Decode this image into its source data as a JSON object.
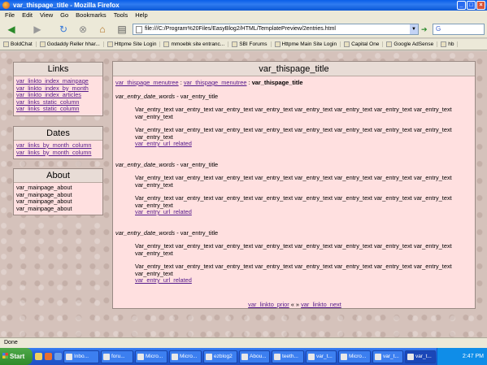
{
  "window": {
    "title": "var_thispage_title - Mozilla Firefox"
  },
  "menu": [
    "File",
    "Edit",
    "View",
    "Go",
    "Bookmarks",
    "Tools",
    "Help"
  ],
  "toolbar": {
    "url": "file:///C:/Program%20Files/EasyBlog2/HTML/TemplatePreview/2entries.html",
    "search_placeholder": "G"
  },
  "bookmarks": [
    "BoldChat",
    "Godaddy Reller hhar...",
    "Httpme Site Login",
    "mmoebk site entranc...",
    "SBI Forums",
    "Httpme Main Site Login",
    "Capital One",
    "Google AdSense",
    "hb"
  ],
  "sidebar": {
    "links": {
      "title": "Links",
      "items": [
        "var_linkto_index_mainpage",
        "var_linkto_index_by_month",
        "var_linkto_index_articles",
        "var_links_static_column",
        "var_links_static_column"
      ]
    },
    "dates": {
      "title": "Dates",
      "items": [
        "var_links_by_month_column",
        "var_links_by_month_column"
      ]
    },
    "about": {
      "title": "About",
      "items": [
        "var_mainpage_about",
        "var_mainpage_about",
        "var_mainpage_about",
        "var_mainpage_about"
      ]
    }
  },
  "main": {
    "title": "var_thispage_title",
    "crumb1": "var_thispage_menutree",
    "crumb2": "var_thispage_menutree",
    "crumb3": "var_thispage_title",
    "separator": ":",
    "entry": {
      "date": "var_entry_date_words",
      "dash": " - ",
      "title": "var_entry_title",
      "text1": "Var_entry_text var_entry_text var_entry_text var_entry_text var_entry_text var_entry_text var_entry_text var_entry_text var_entry_text",
      "text2": "Var_entry_text var_entry_text var_entry_text var_entry_text var_entry_text var_entry_text var_entry_text var_entry_text var_entry_text",
      "url": "var_entry_url_related"
    },
    "nav": {
      "prior": "var_linkto_prior",
      "sep": " « » ",
      "next": "var_linkto_next"
    }
  },
  "status": "Done",
  "taskbar": {
    "start": "Start",
    "tasks": [
      "Inbo...",
      "foru...",
      "Micro...",
      "Micro...",
      "ezblog2",
      "Abou...",
      "teeth...",
      "var_t...",
      "Micro...",
      "var_t...",
      "var_t..."
    ],
    "clock": "2:47 PM"
  }
}
